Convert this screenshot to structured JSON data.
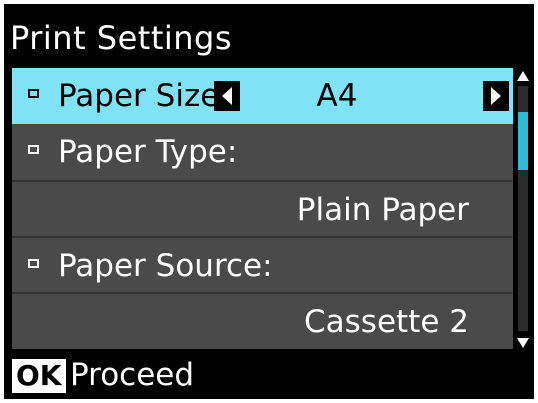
{
  "screen": {
    "title": "Print Settings"
  },
  "menu": {
    "items": [
      {
        "label": "Paper Size :",
        "value": "A4",
        "selected": true
      },
      {
        "label": "Paper Type:",
        "value": "Plain Paper"
      },
      {
        "label": "Paper Source:",
        "value": "Cassette 2"
      }
    ]
  },
  "icons": {
    "bullet": "square-bullet-icon",
    "left": "left-arrow-icon",
    "right": "right-arrow-icon",
    "scroll_up": "scroll-up-arrow-icon",
    "scroll_down": "scroll-down-arrow-icon"
  },
  "footer": {
    "key": "OK",
    "action": "Proceed"
  },
  "colors": {
    "highlight": "#7fe3f5",
    "panel": "#4a4a4a",
    "scroll_thumb": "#2fbad3",
    "background": "#000000"
  }
}
